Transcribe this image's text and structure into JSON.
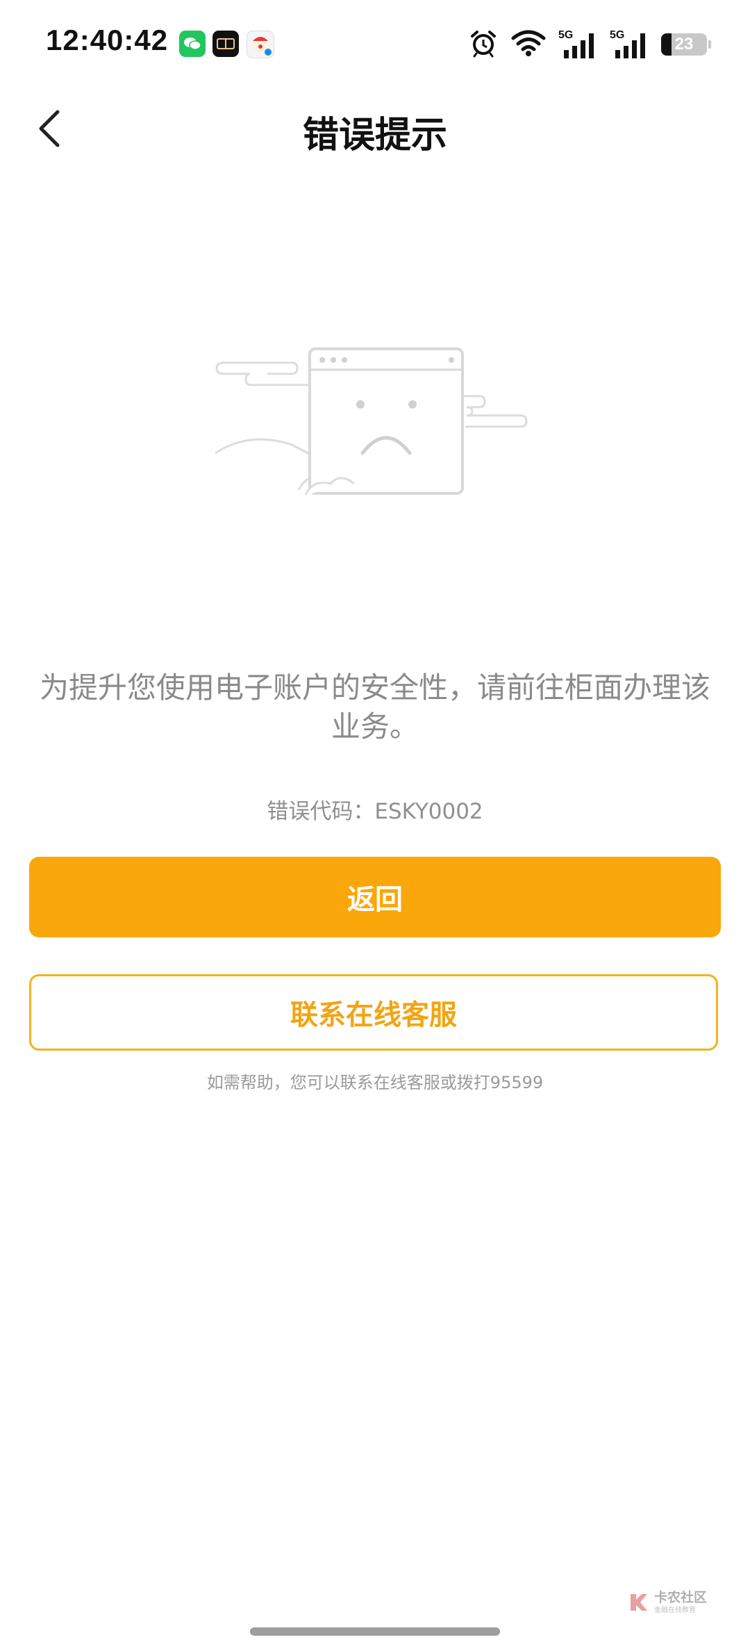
{
  "status_bar": {
    "time": "12:40:42",
    "network_1": "5G",
    "network_2": "5G",
    "battery_level": "23",
    "battery_fraction": 0.23
  },
  "nav": {
    "title": "错误提示"
  },
  "error": {
    "message": "为提升您使用电子账户的安全性，请前往柜面办理该业务。",
    "code": "错误代码：ESKY0002"
  },
  "buttons": {
    "return_label": "返回",
    "service_label": "联系在线客服"
  },
  "help_text": "如需帮助，您可以联系在线客服或拨打95599",
  "watermark": {
    "title": "卡农社区",
    "subtitle": "金融在线教育"
  },
  "colors": {
    "accent": "#f9a70a",
    "outline": "#f2b320"
  }
}
